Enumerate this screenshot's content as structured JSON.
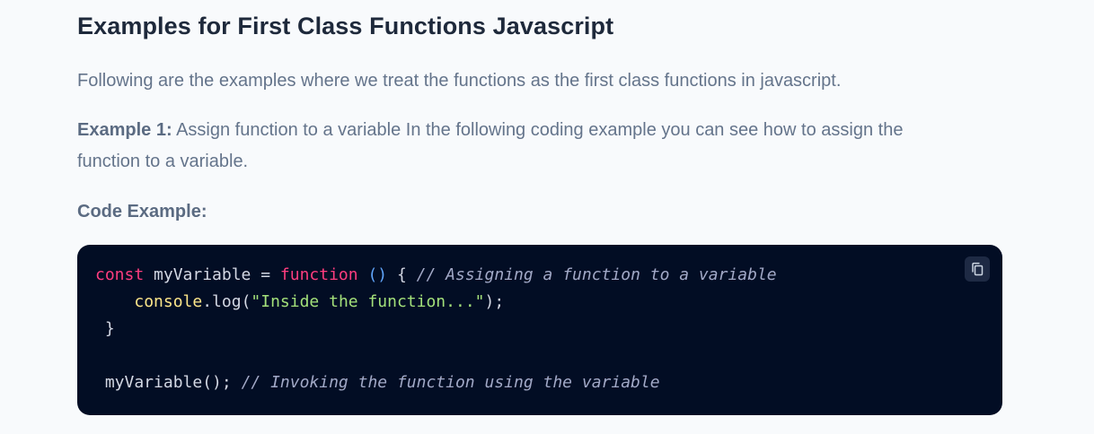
{
  "article": {
    "heading": "Examples for First Class Functions Javascript",
    "intro": "Following are the examples where we treat the functions as the first class functions in javascript.",
    "example1": {
      "label": "Example 1:",
      "text": " Assign function to a variable In the following coding example you can see how to assign the function to a variable."
    },
    "code_label": "Code Example:"
  },
  "code_block": {
    "copy_icon": "copy-icon",
    "tokens": {
      "t1": "const",
      "t2": " myVariable = ",
      "t3": "function",
      "t4": " ",
      "t5": "()",
      "t6": " { ",
      "t7": "// Assigning a function to a variable",
      "t8": "    ",
      "t9": "console",
      "t10": ".log(",
      "t11": "\"Inside the function...\"",
      "t12": ");",
      "t13": " }",
      "t14": " myVariable(); ",
      "t15": "// Invoking the function using the variable"
    }
  },
  "colors": {
    "page_bg": "#f8fafc",
    "code_bg": "#020d24",
    "keyword": "#ff3d7f",
    "string": "#a3e07a",
    "comment": "#a2a9c7",
    "object": "#fde68a"
  }
}
